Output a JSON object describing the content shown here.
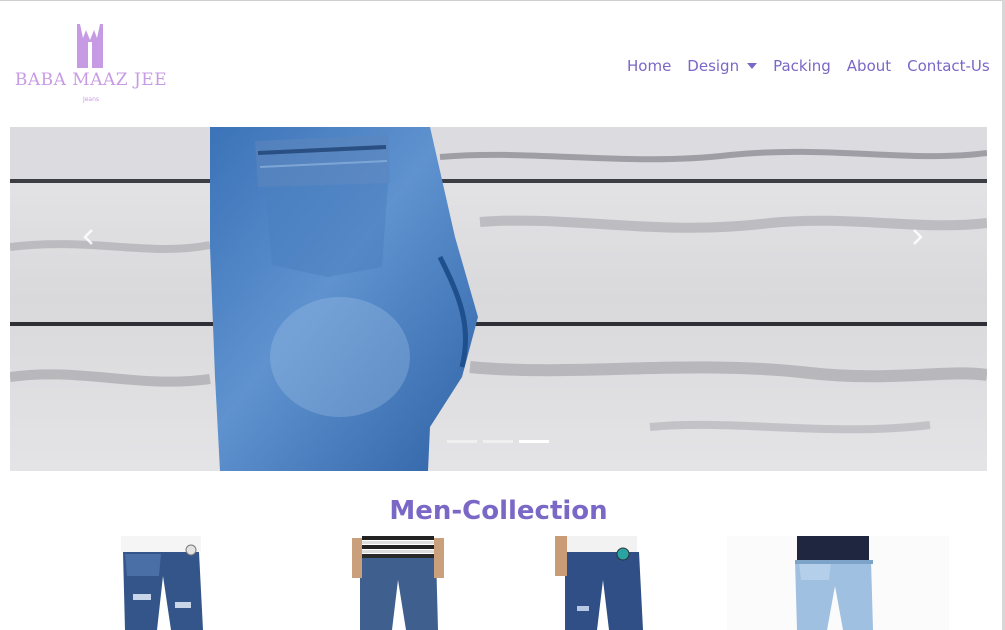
{
  "brand": {
    "name": "BABA MAAZ JEE",
    "tagline": "Jeans",
    "color": "#c79be4"
  },
  "nav": {
    "items": [
      {
        "label": "Home"
      },
      {
        "label": "Design",
        "dropdown": true
      },
      {
        "label": "Packing"
      },
      {
        "label": "About"
      },
      {
        "label": "Contact-Us"
      }
    ],
    "color": "#7a67c6"
  },
  "carousel": {
    "prev_icon": "chevron-left-icon",
    "next_icon": "chevron-right-icon",
    "slides_count": 3,
    "active_slide": 3
  },
  "collection": {
    "title": "Men-Collection",
    "products": [
      {
        "icon": "ripped-jeans-photo"
      },
      {
        "icon": "striped-shirt-jeans-photo"
      },
      {
        "icon": "distressed-jeans-photo"
      },
      {
        "icon": "light-wash-jeans-photo"
      }
    ]
  }
}
